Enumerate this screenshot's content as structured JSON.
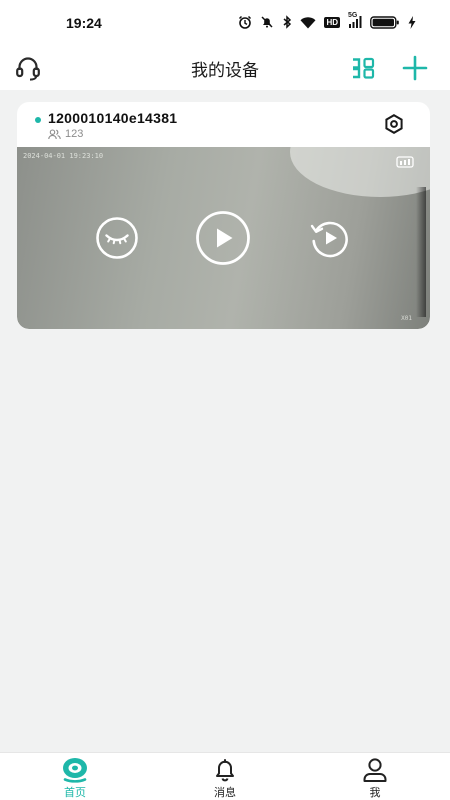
{
  "status": {
    "time": "19:24",
    "network_label": "5G",
    "hd_label": "HD"
  },
  "header": {
    "title": "我的设备",
    "support_icon": "headset-icon",
    "view_toggle_icon": "grid-view-icon",
    "add_icon": "plus-icon"
  },
  "device": {
    "name": "1200010140e14381",
    "shared_group": "123",
    "online": true,
    "status_color": "#1eb7a9"
  },
  "video": {
    "timestamp": "2024-04-01  19:23:10",
    "corner_label": "X01",
    "controls": [
      "sleep-eye-icon",
      "play-icon",
      "replay-icon"
    ]
  },
  "tabs": [
    {
      "label": "首页",
      "icon": "home-camera-icon",
      "active": true
    },
    {
      "label": "消息",
      "icon": "bell-icon",
      "active": false
    },
    {
      "label": "我",
      "icon": "user-icon",
      "active": false
    }
  ],
  "colors": {
    "accent": "#1eb7a9",
    "background": "#f1f2f2"
  }
}
